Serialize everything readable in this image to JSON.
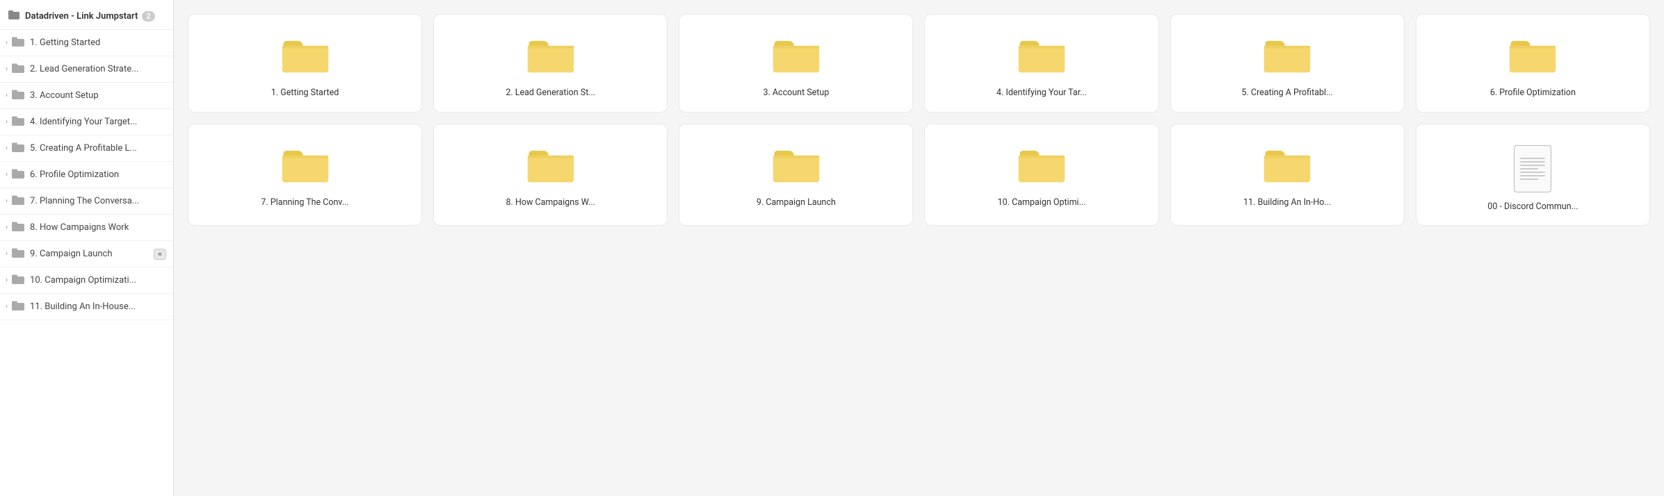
{
  "sidebar": {
    "header_label": "Datadriven - Link Jumpstart",
    "header_badge": "2",
    "items": [
      {
        "label": "1. Getting Started",
        "id": "sidebar-item-1"
      },
      {
        "label": "2. Lead Generation Strate...",
        "id": "sidebar-item-2"
      },
      {
        "label": "3. Account Setup",
        "id": "sidebar-item-3"
      },
      {
        "label": "4. Identifying Your Target...",
        "id": "sidebar-item-4"
      },
      {
        "label": "5. Creating A Profitable L...",
        "id": "sidebar-item-5"
      },
      {
        "label": "6. Profile Optimization",
        "id": "sidebar-item-6"
      },
      {
        "label": "7. Planning The Conversa...",
        "id": "sidebar-item-7"
      },
      {
        "label": "8. How Campaigns Work",
        "id": "sidebar-item-8"
      },
      {
        "label": "9. Campaign Launch",
        "id": "sidebar-item-9",
        "has_collapse": true
      },
      {
        "label": "10. Campaign Optimizati...",
        "id": "sidebar-item-10"
      },
      {
        "label": "11. Building An In-House...",
        "id": "sidebar-item-11"
      }
    ]
  },
  "grid": {
    "row1": [
      {
        "label": "1. Getting Started",
        "type": "folder"
      },
      {
        "label": "2. Lead Generation St...",
        "type": "folder"
      },
      {
        "label": "3. Account Setup",
        "type": "folder"
      },
      {
        "label": "4. Identifying Your Tar...",
        "type": "folder"
      },
      {
        "label": "5. Creating A Profitabl...",
        "type": "folder"
      },
      {
        "label": "6. Profile Optimization",
        "type": "folder"
      }
    ],
    "row2": [
      {
        "label": "7. Planning The Conv...",
        "type": "folder"
      },
      {
        "label": "8. How Campaigns W...",
        "type": "folder"
      },
      {
        "label": "9. Campaign Launch",
        "type": "folder"
      },
      {
        "label": "10. Campaign Optimi...",
        "type": "folder"
      },
      {
        "label": "11. Building An In-Ho...",
        "type": "folder"
      },
      {
        "label": "00 - Discord Commun...",
        "type": "document"
      }
    ]
  },
  "colors": {
    "folder_body": "#f5d76e",
    "folder_tab": "#e8c84a",
    "folder_border": "#d4a800"
  }
}
